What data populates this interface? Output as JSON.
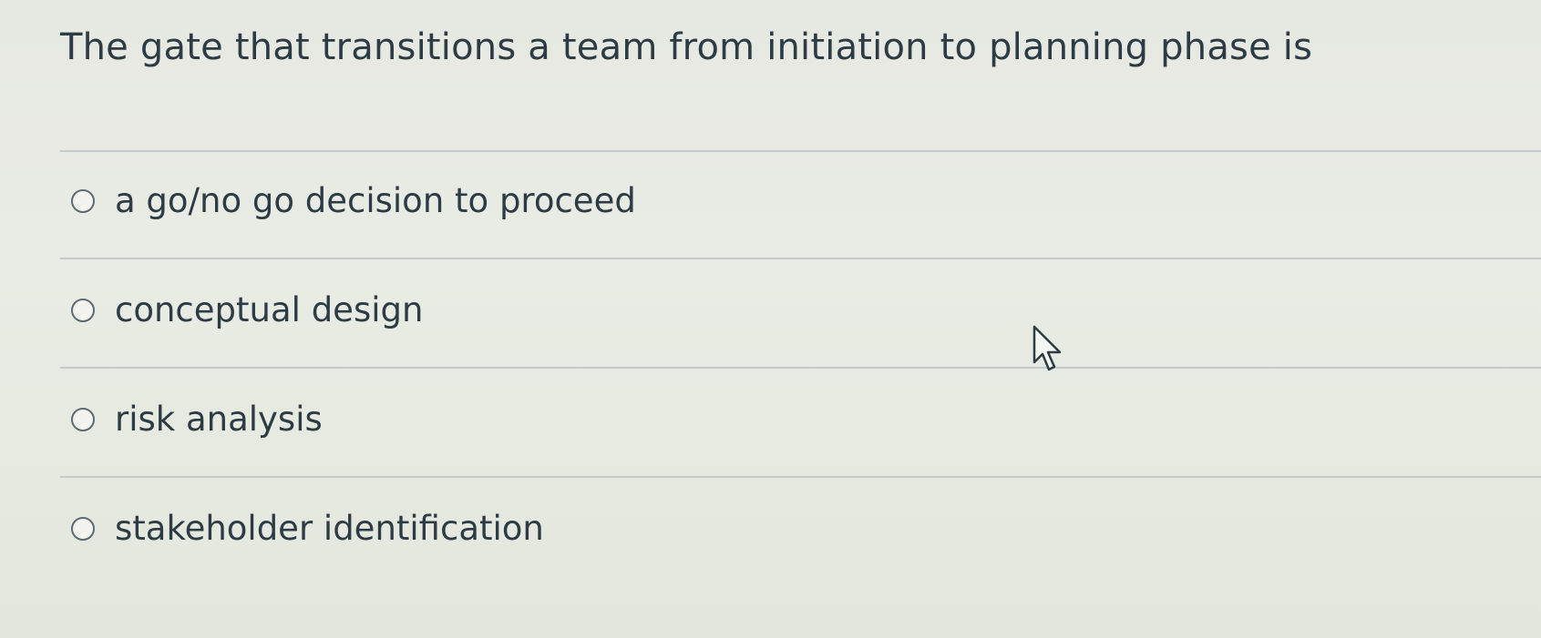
{
  "question": {
    "text": "The gate that transitions a team from initiation to planning phase is"
  },
  "answers": [
    {
      "label": "a go/no go decision to proceed",
      "selected": false
    },
    {
      "label": "conceptual design",
      "selected": false
    },
    {
      "label": "risk analysis",
      "selected": false
    },
    {
      "label": "stakeholder identification",
      "selected": false
    }
  ],
  "cursor": {
    "icon": "pointer-cursor-icon"
  }
}
